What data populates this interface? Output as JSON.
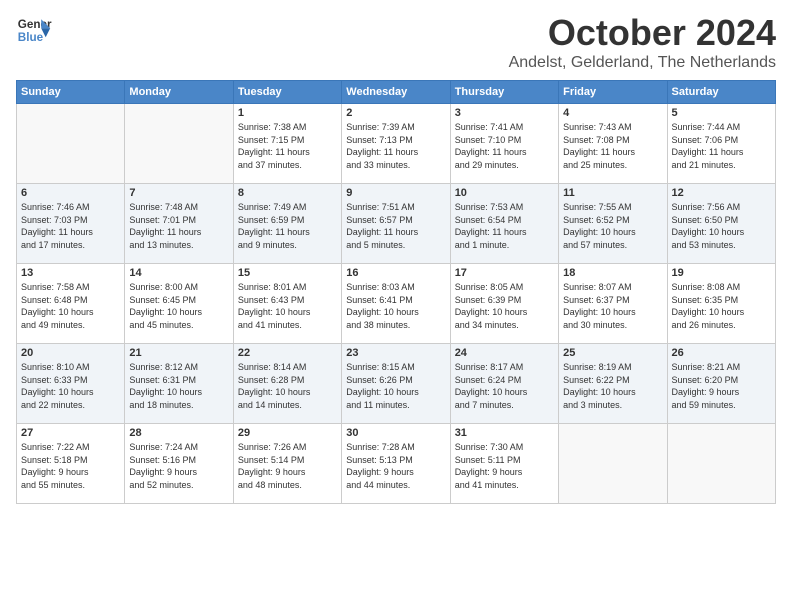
{
  "logo": {
    "line1": "General",
    "line2": "Blue"
  },
  "title": "October 2024",
  "location": "Andelst, Gelderland, The Netherlands",
  "days_of_week": [
    "Sunday",
    "Monday",
    "Tuesday",
    "Wednesday",
    "Thursday",
    "Friday",
    "Saturday"
  ],
  "weeks": [
    [
      {
        "day": "",
        "info": ""
      },
      {
        "day": "",
        "info": ""
      },
      {
        "day": "1",
        "info": "Sunrise: 7:38 AM\nSunset: 7:15 PM\nDaylight: 11 hours\nand 37 minutes."
      },
      {
        "day": "2",
        "info": "Sunrise: 7:39 AM\nSunset: 7:13 PM\nDaylight: 11 hours\nand 33 minutes."
      },
      {
        "day": "3",
        "info": "Sunrise: 7:41 AM\nSunset: 7:10 PM\nDaylight: 11 hours\nand 29 minutes."
      },
      {
        "day": "4",
        "info": "Sunrise: 7:43 AM\nSunset: 7:08 PM\nDaylight: 11 hours\nand 25 minutes."
      },
      {
        "day": "5",
        "info": "Sunrise: 7:44 AM\nSunset: 7:06 PM\nDaylight: 11 hours\nand 21 minutes."
      }
    ],
    [
      {
        "day": "6",
        "info": "Sunrise: 7:46 AM\nSunset: 7:03 PM\nDaylight: 11 hours\nand 17 minutes."
      },
      {
        "day": "7",
        "info": "Sunrise: 7:48 AM\nSunset: 7:01 PM\nDaylight: 11 hours\nand 13 minutes."
      },
      {
        "day": "8",
        "info": "Sunrise: 7:49 AM\nSunset: 6:59 PM\nDaylight: 11 hours\nand 9 minutes."
      },
      {
        "day": "9",
        "info": "Sunrise: 7:51 AM\nSunset: 6:57 PM\nDaylight: 11 hours\nand 5 minutes."
      },
      {
        "day": "10",
        "info": "Sunrise: 7:53 AM\nSunset: 6:54 PM\nDaylight: 11 hours\nand 1 minute."
      },
      {
        "day": "11",
        "info": "Sunrise: 7:55 AM\nSunset: 6:52 PM\nDaylight: 10 hours\nand 57 minutes."
      },
      {
        "day": "12",
        "info": "Sunrise: 7:56 AM\nSunset: 6:50 PM\nDaylight: 10 hours\nand 53 minutes."
      }
    ],
    [
      {
        "day": "13",
        "info": "Sunrise: 7:58 AM\nSunset: 6:48 PM\nDaylight: 10 hours\nand 49 minutes."
      },
      {
        "day": "14",
        "info": "Sunrise: 8:00 AM\nSunset: 6:45 PM\nDaylight: 10 hours\nand 45 minutes."
      },
      {
        "day": "15",
        "info": "Sunrise: 8:01 AM\nSunset: 6:43 PM\nDaylight: 10 hours\nand 41 minutes."
      },
      {
        "day": "16",
        "info": "Sunrise: 8:03 AM\nSunset: 6:41 PM\nDaylight: 10 hours\nand 38 minutes."
      },
      {
        "day": "17",
        "info": "Sunrise: 8:05 AM\nSunset: 6:39 PM\nDaylight: 10 hours\nand 34 minutes."
      },
      {
        "day": "18",
        "info": "Sunrise: 8:07 AM\nSunset: 6:37 PM\nDaylight: 10 hours\nand 30 minutes."
      },
      {
        "day": "19",
        "info": "Sunrise: 8:08 AM\nSunset: 6:35 PM\nDaylight: 10 hours\nand 26 minutes."
      }
    ],
    [
      {
        "day": "20",
        "info": "Sunrise: 8:10 AM\nSunset: 6:33 PM\nDaylight: 10 hours\nand 22 minutes."
      },
      {
        "day": "21",
        "info": "Sunrise: 8:12 AM\nSunset: 6:31 PM\nDaylight: 10 hours\nand 18 minutes."
      },
      {
        "day": "22",
        "info": "Sunrise: 8:14 AM\nSunset: 6:28 PM\nDaylight: 10 hours\nand 14 minutes."
      },
      {
        "day": "23",
        "info": "Sunrise: 8:15 AM\nSunset: 6:26 PM\nDaylight: 10 hours\nand 11 minutes."
      },
      {
        "day": "24",
        "info": "Sunrise: 8:17 AM\nSunset: 6:24 PM\nDaylight: 10 hours\nand 7 minutes."
      },
      {
        "day": "25",
        "info": "Sunrise: 8:19 AM\nSunset: 6:22 PM\nDaylight: 10 hours\nand 3 minutes."
      },
      {
        "day": "26",
        "info": "Sunrise: 8:21 AM\nSunset: 6:20 PM\nDaylight: 9 hours\nand 59 minutes."
      }
    ],
    [
      {
        "day": "27",
        "info": "Sunrise: 7:22 AM\nSunset: 5:18 PM\nDaylight: 9 hours\nand 55 minutes."
      },
      {
        "day": "28",
        "info": "Sunrise: 7:24 AM\nSunset: 5:16 PM\nDaylight: 9 hours\nand 52 minutes."
      },
      {
        "day": "29",
        "info": "Sunrise: 7:26 AM\nSunset: 5:14 PM\nDaylight: 9 hours\nand 48 minutes."
      },
      {
        "day": "30",
        "info": "Sunrise: 7:28 AM\nSunset: 5:13 PM\nDaylight: 9 hours\nand 44 minutes."
      },
      {
        "day": "31",
        "info": "Sunrise: 7:30 AM\nSunset: 5:11 PM\nDaylight: 9 hours\nand 41 minutes."
      },
      {
        "day": "",
        "info": ""
      },
      {
        "day": "",
        "info": ""
      }
    ]
  ]
}
